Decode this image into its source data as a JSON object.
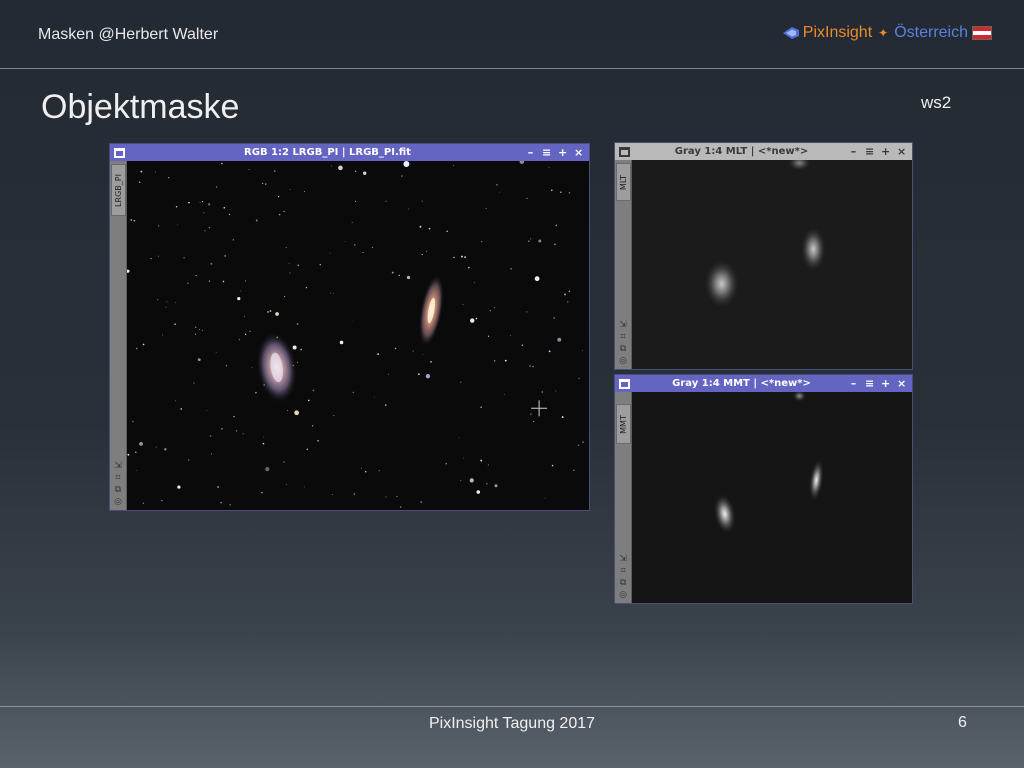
{
  "header": {
    "author": "Masken  @Herbert Walter",
    "brand_name": "PixInsight",
    "brand_sep": "✦",
    "brand_country": "Österreich"
  },
  "slide": {
    "title": "Objektmaske",
    "tag": "ws2"
  },
  "windows": {
    "main": {
      "title": "RGB 1:2 LRGB_PI | LRGB_PI.fit",
      "side_tab": "LRGB_PI"
    },
    "mlt": {
      "title": "Gray 1:4 MLT | <*new*>",
      "side_tab": "MLT"
    },
    "mmt": {
      "title": "Gray 1:4 MMT | <*new*>",
      "side_tab": "MMT"
    }
  },
  "controls": {
    "minimize": "–",
    "shade": "≡",
    "maximize": "+",
    "close": "×"
  },
  "side_tool_icons": [
    "⇲",
    "⌗",
    "⧉",
    "◎"
  ],
  "footer": {
    "event": "PixInsight Tagung 2017",
    "page_number": "6"
  },
  "colors": {
    "active_title": "#6465c2",
    "inactive_title": "#b9b9b9",
    "brand_orange": "#e98a2a",
    "brand_blue": "#5a7fe0"
  }
}
